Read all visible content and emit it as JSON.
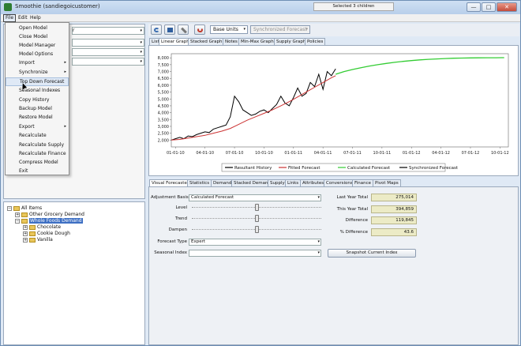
{
  "window": {
    "title": "Smoothie (sandiegoicustomer)",
    "controls": [
      "—",
      "□",
      "✕"
    ]
  },
  "menubar": {
    "items": [
      "File",
      "Edit",
      "Help"
    ]
  },
  "file_menu": {
    "items": [
      {
        "label": "Open Model",
        "submenu": false
      },
      {
        "label": "Close Model",
        "submenu": false
      },
      {
        "label": "Model Manager",
        "submenu": false
      },
      {
        "label": "Model Options",
        "submenu": false
      },
      {
        "label": "Import",
        "submenu": true
      },
      {
        "label": "Synchronize",
        "submenu": true
      },
      {
        "label": "Top Down Forecast",
        "submenu": false,
        "highlighted": true
      },
      {
        "label": "Seasonal Indexes",
        "submenu": false
      },
      {
        "label": "Copy History",
        "submenu": false
      },
      {
        "label": "Backup Model",
        "submenu": false
      },
      {
        "label": "Restore Model",
        "submenu": false
      },
      {
        "label": "Export",
        "submenu": true
      },
      {
        "label": "Recalculate",
        "submenu": false
      },
      {
        "label": "Recalculate Supply",
        "submenu": false
      },
      {
        "label": "Recalculate Finance",
        "submenu": false
      },
      {
        "label": "Compress Model",
        "submenu": false
      },
      {
        "label": "Exit",
        "submenu": false
      }
    ],
    "submenu_arrow": "▸"
  },
  "left_top": {
    "combo_value": "r",
    "combo_arrow": "▾"
  },
  "tree": {
    "root": "All Items",
    "items": [
      {
        "label": "Other Grocery Demand",
        "level": 1,
        "toggle": "+"
      },
      {
        "label": "Whole Foods Demand",
        "level": 1,
        "toggle": "−",
        "selected": true
      },
      {
        "label": "Chocolate",
        "level": 2,
        "toggle": "+"
      },
      {
        "label": "Cookie Dough",
        "level": 2,
        "toggle": "+"
      },
      {
        "label": "Vanilla",
        "level": 2,
        "toggle": "+"
      }
    ],
    "root_toggle": "−"
  },
  "toolbar": {
    "units": "Base Units",
    "forecast_type": "Synchronized Forecast",
    "selection": "Selected 3 children",
    "icons": [
      "refresh-icon",
      "save-icon",
      "edit-icon",
      "sync-icon"
    ]
  },
  "graph_tabs": [
    "List",
    "Linear Graph",
    "Stacked Graph",
    "Notes",
    "Min-Max Graph",
    "Supply Graph",
    "Policies"
  ],
  "graph_tabs_active": 1,
  "chart_data": {
    "type": "line",
    "title": "",
    "xlabel": "",
    "ylabel": "",
    "ylim": [
      1500,
      8300
    ],
    "yticks": [
      2000,
      2500,
      3000,
      3500,
      4000,
      4500,
      5000,
      5500,
      6000,
      6500,
      7000,
      7500,
      8000
    ],
    "ytick_labels": [
      "2,000",
      "2,500",
      "3,000",
      "3,500",
      "4,000",
      "4,500",
      "5,000",
      "5,500",
      "6,000",
      "6,500",
      "7,000",
      "7,500",
      "8,000"
    ],
    "xtick_labels": [
      "01-01-10",
      "04-01-10",
      "07-01-10",
      "10-01-10",
      "01-01-11",
      "04-01-11",
      "07-01-11",
      "10-01-11",
      "01-01-12",
      "04-01-12",
      "07-01-12",
      "10-01-12"
    ],
    "grid": false,
    "legend": "bottom",
    "series": [
      {
        "name": "Resultant History",
        "color": "#000000",
        "x": [
          0.0,
          0.25,
          0.5,
          0.75,
          1.0,
          1.25,
          1.5,
          1.75,
          2.0,
          2.25,
          2.5,
          2.75,
          3.0,
          3.25,
          3.5,
          3.75,
          4.0,
          4.25,
          4.5,
          4.75,
          5.0,
          5.25,
          5.5,
          5.75,
          6.0,
          6.25,
          6.5,
          6.75,
          7.0,
          7.25,
          7.5,
          7.75,
          8.0,
          8.25,
          8.5,
          8.75,
          9.0,
          9.25,
          9.5,
          9.75
        ],
        "y": [
          2000,
          2100,
          2200,
          2100,
          2300,
          2250,
          2400,
          2500,
          2600,
          2550,
          2800,
          2900,
          3000,
          3100,
          3700,
          5200,
          4800,
          4200,
          4000,
          3800,
          3900,
          4100,
          4200,
          4000,
          4300,
          4600,
          5200,
          4700,
          4500,
          5100,
          5800,
          5200,
          5400,
          6200,
          5900,
          6800,
          5700,
          7000,
          6700,
          7200
        ]
      },
      {
        "name": "Fitted Forecast",
        "color": "#cc3333",
        "x": [
          0.0,
          0.5,
          1.0,
          1.5,
          2.0,
          2.5,
          3.0,
          3.5,
          4.0,
          4.5,
          5.0,
          5.5,
          6.0,
          6.5,
          7.0,
          7.5,
          8.0,
          8.5,
          9.0,
          9.5,
          9.75
        ],
        "y": [
          2000,
          2050,
          2150,
          2250,
          2350,
          2500,
          2650,
          2850,
          3150,
          3450,
          3700,
          3950,
          4200,
          4500,
          4800,
          5150,
          5500,
          5850,
          6200,
          6550,
          6700
        ]
      },
      {
        "name": "Calculated Forecast",
        "color": "#33cc33",
        "x": [
          9.75,
          10.25,
          10.75,
          11.25,
          11.75,
          12.25,
          12.75,
          13.25,
          13.75,
          14.25,
          14.75,
          15.25,
          15.75,
          16.25,
          16.75,
          17.25,
          17.75,
          18.25,
          18.75,
          19.25,
          19.75
        ],
        "y": [
          6800,
          7000,
          7150,
          7280,
          7400,
          7500,
          7590,
          7670,
          7740,
          7800,
          7850,
          7890,
          7920,
          7950,
          7970,
          7985,
          7995,
          8000,
          8005,
          8008,
          8010
        ]
      },
      {
        "name": "Synchronized Forecast",
        "color": "#000000",
        "x": [],
        "y": []
      }
    ]
  },
  "bottom_tabs": [
    "Visual Forecaster",
    "Statistics",
    "Demand",
    "Stacked Demand",
    "Supply",
    "Links",
    "Attributes",
    "Conversions",
    "Finance",
    "Pivot Maps"
  ],
  "bottom_tabs_active": 0,
  "forecaster": {
    "adjustment_basis_label": "Adjustment Basis",
    "adjustment_basis_value": "Calculated Forecast",
    "level_label": "Level",
    "trend_label": "Trend",
    "dampen_label": "Dampen",
    "level_pos": 0.5,
    "trend_pos": 0.5,
    "dampen_pos": 0.5,
    "forecast_type_label": "Forecast Type",
    "forecast_type_value": "Expert",
    "seasonal_index_label": "Seasonal Index",
    "seasonal_index_value": "",
    "last_year_total_label": "Last Year Total",
    "last_year_total": "275,014",
    "this_year_total_label": "This Year Total",
    "this_year_total": "394,859",
    "difference_label": "Difference",
    "difference": "119,845",
    "pct_difference_label": "% Difference",
    "pct_difference": "43.6",
    "snapshot_button": "Snapshot Current Index",
    "arrow": "▾"
  }
}
